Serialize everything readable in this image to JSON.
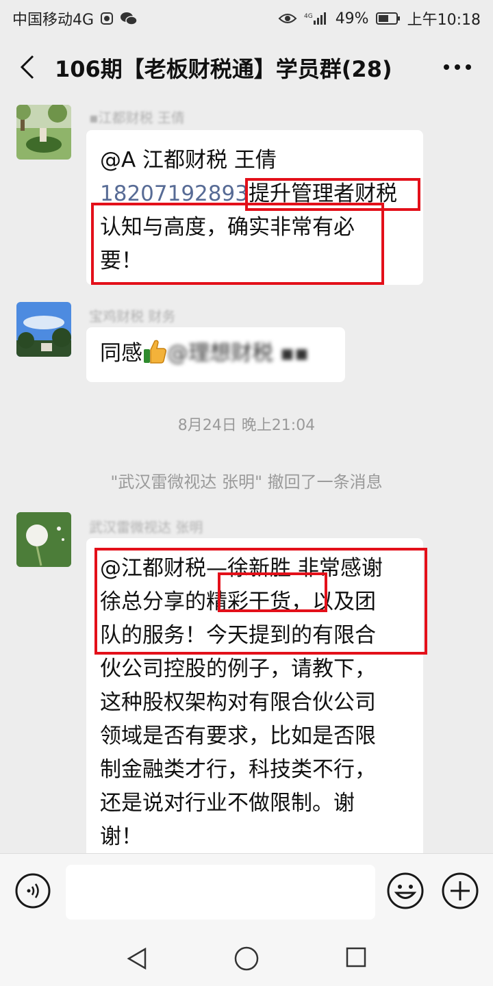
{
  "status_bar": {
    "carrier": "中国移动4G",
    "network": "4G",
    "battery": "49%",
    "time": "上午10:18"
  },
  "title_bar": {
    "title": "106期【老板财税通】学员群(28)"
  },
  "messages": [
    {
      "sender": "▪江都财税 王倩",
      "mention": "@A 江都财税 王倩",
      "phone": "18207192893",
      "text_boxed": "提升管理者财税",
      "text_rest_1": "认知与高度，确实非常有必",
      "text_rest_2": "要！"
    },
    {
      "sender": "宝鸡财税 财务",
      "text": "同感",
      "mention_blurred": "@理想财税 ▪▪"
    },
    {
      "sender": "武汉雷微视达 张明",
      "line1": "@江都财税—徐新胜  非常感谢",
      "line2_a": "徐总分享的",
      "line2_boxed": "精彩干货",
      "line2_b": "，以及团",
      "line3": "队的服务！今天提到的有限合",
      "line4": "伙公司控股的例子，请教下，",
      "line5": "这种股权架构对有限合伙公司",
      "line6": "领域是否有要求，比如是否限",
      "line7": "制金融类才行，科技类不行，",
      "line8": "还是说对行业不做限制。谢",
      "line9": "谢！"
    }
  ],
  "timestamp": "8月24日 晚上21:04",
  "system_message": "\"武汉雷微视达 张明\" 撤回了一条消息",
  "input": {
    "placeholder": ""
  },
  "colors": {
    "background": "#ededed",
    "bubble": "#ffffff",
    "highlight_box": "#e3101a",
    "link": "#576b95"
  },
  "icons": [
    "eye-icon",
    "signal-icon",
    "battery-icon",
    "back-icon",
    "more-icon",
    "voice-icon",
    "emoji-icon",
    "plus-icon",
    "nav-back-icon",
    "nav-home-icon",
    "nav-recent-icon"
  ]
}
